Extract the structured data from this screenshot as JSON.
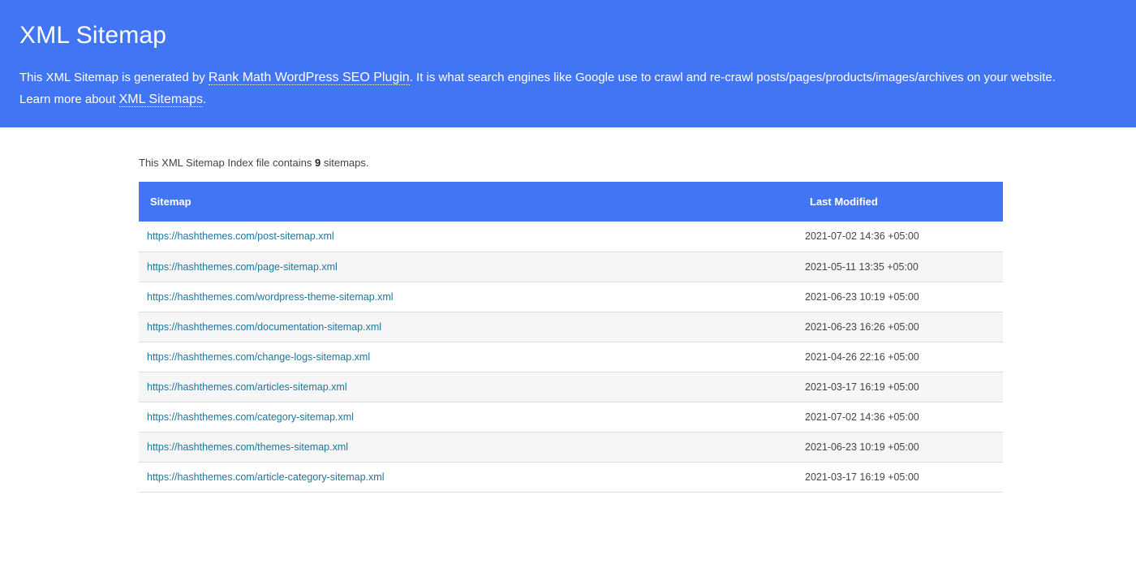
{
  "header": {
    "title": "XML Sitemap",
    "desc_part1": "This XML Sitemap is generated by ",
    "plugin_link": "Rank Math WordPress SEO Plugin",
    "desc_part2": ". It is what search engines like Google use to crawl and re-crawl posts/pages/products/images/archives on your website.",
    "desc_part3": "Learn more about ",
    "sitemaps_link": "XML Sitemaps",
    "desc_part4": "."
  },
  "summary": {
    "prefix": "This XML Sitemap Index file contains ",
    "count": "9",
    "suffix": " sitemaps."
  },
  "table": {
    "headers": {
      "sitemap": "Sitemap",
      "last_modified": "Last Modified"
    },
    "rows": [
      {
        "url": "https://hashthemes.com/post-sitemap.xml",
        "modified": "2021-07-02 14:36 +05:00"
      },
      {
        "url": "https://hashthemes.com/page-sitemap.xml",
        "modified": "2021-05-11 13:35 +05:00"
      },
      {
        "url": "https://hashthemes.com/wordpress-theme-sitemap.xml",
        "modified": "2021-06-23 10:19 +05:00"
      },
      {
        "url": "https://hashthemes.com/documentation-sitemap.xml",
        "modified": "2021-06-23 16:26 +05:00"
      },
      {
        "url": "https://hashthemes.com/change-logs-sitemap.xml",
        "modified": "2021-04-26 22:16 +05:00"
      },
      {
        "url": "https://hashthemes.com/articles-sitemap.xml",
        "modified": "2021-03-17 16:19 +05:00"
      },
      {
        "url": "https://hashthemes.com/category-sitemap.xml",
        "modified": "2021-07-02 14:36 +05:00"
      },
      {
        "url": "https://hashthemes.com/themes-sitemap.xml",
        "modified": "2021-06-23 10:19 +05:00"
      },
      {
        "url": "https://hashthemes.com/article-category-sitemap.xml",
        "modified": "2021-03-17 16:19 +05:00"
      }
    ]
  }
}
